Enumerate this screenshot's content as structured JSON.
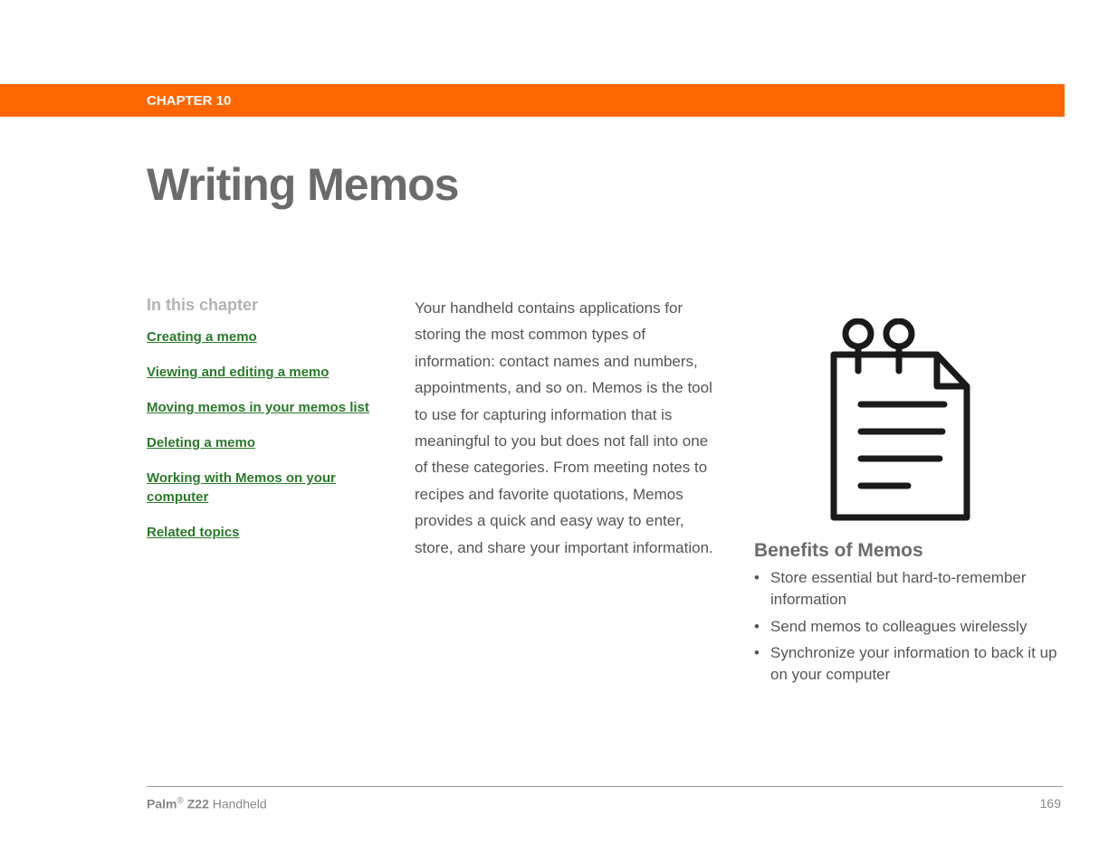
{
  "chapter": "CHAPTER 10",
  "title": "Writing Memos",
  "toc": {
    "heading": "In this chapter",
    "items": [
      "Creating a memo",
      "Viewing and editing a memo",
      "Moving memos in your memos list",
      "Deleting a memo",
      "Working with Memos on your computer",
      "Related topics"
    ]
  },
  "body": "Your handheld contains applications for storing the most common types of information: contact names and numbers, appointments, and so on. Memos is the tool to use for capturing information that is meaningful to you but does not fall into one of these categories. From meeting notes to recipes and favorite quotations, Memos provides a quick and easy way to enter, store, and share your important information.",
  "benefits": {
    "heading": "Benefits of Memos",
    "items": [
      "Store essential but hard-to-remember information",
      "Send memos to colleagues wirelessly",
      "Synchronize your information to back it up on your computer"
    ]
  },
  "footer": {
    "brand": "Palm",
    "reg": "®",
    "model": "Z22",
    "device": "Handheld",
    "page": "169"
  }
}
